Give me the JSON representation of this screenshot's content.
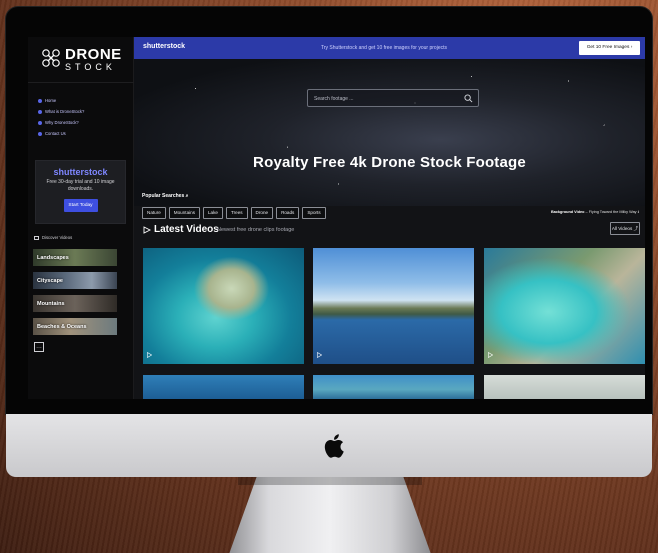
{
  "sidebar": {
    "logo_line1": "DRONE",
    "logo_line2": "STOCK",
    "nav": [
      "Home",
      "What is DroneStock?",
      "Why DroneStock?",
      "Contact Us"
    ],
    "promo": {
      "logo": "shutterstock",
      "text": "Free 30-day trial and 10 image downloads.",
      "button": "Start Today"
    },
    "discover_label": "Discover Videos",
    "categories": [
      "Landscapes",
      "Cityscape",
      "Mountains",
      "Beaches & Oceans"
    ],
    "more_button": "…"
  },
  "banner": {
    "logo": "shutterstock",
    "message": "Try Shutterstock and get 10 free images for your projects",
    "button": "Get 10 Free Images  ›"
  },
  "hero": {
    "search_placeholder": "Search footage ...",
    "title": "Royalty Free 4k Drone Stock Footage",
    "popular_label": "Popular Searches",
    "chips": [
      "Nature",
      "Mountains",
      "Lake",
      "Trees",
      "Drone",
      "Roads",
      "Sports"
    ],
    "background_label": "Background Video",
    "background_title": "Flying Toward the Milky Way"
  },
  "latest": {
    "title": "Latest Videos",
    "subtitle": "Newest free drone clips footage",
    "all_button": "All Videos ⤴"
  },
  "colors": {
    "accent": "#3e4fe0",
    "banner": "#2c3aa8",
    "sidebar_bg": "#0b0b0c"
  },
  "icons": [
    "drone-logo-icon",
    "search-icon",
    "play-triangle-icon",
    "download-icon",
    "apple-logo-icon"
  ]
}
